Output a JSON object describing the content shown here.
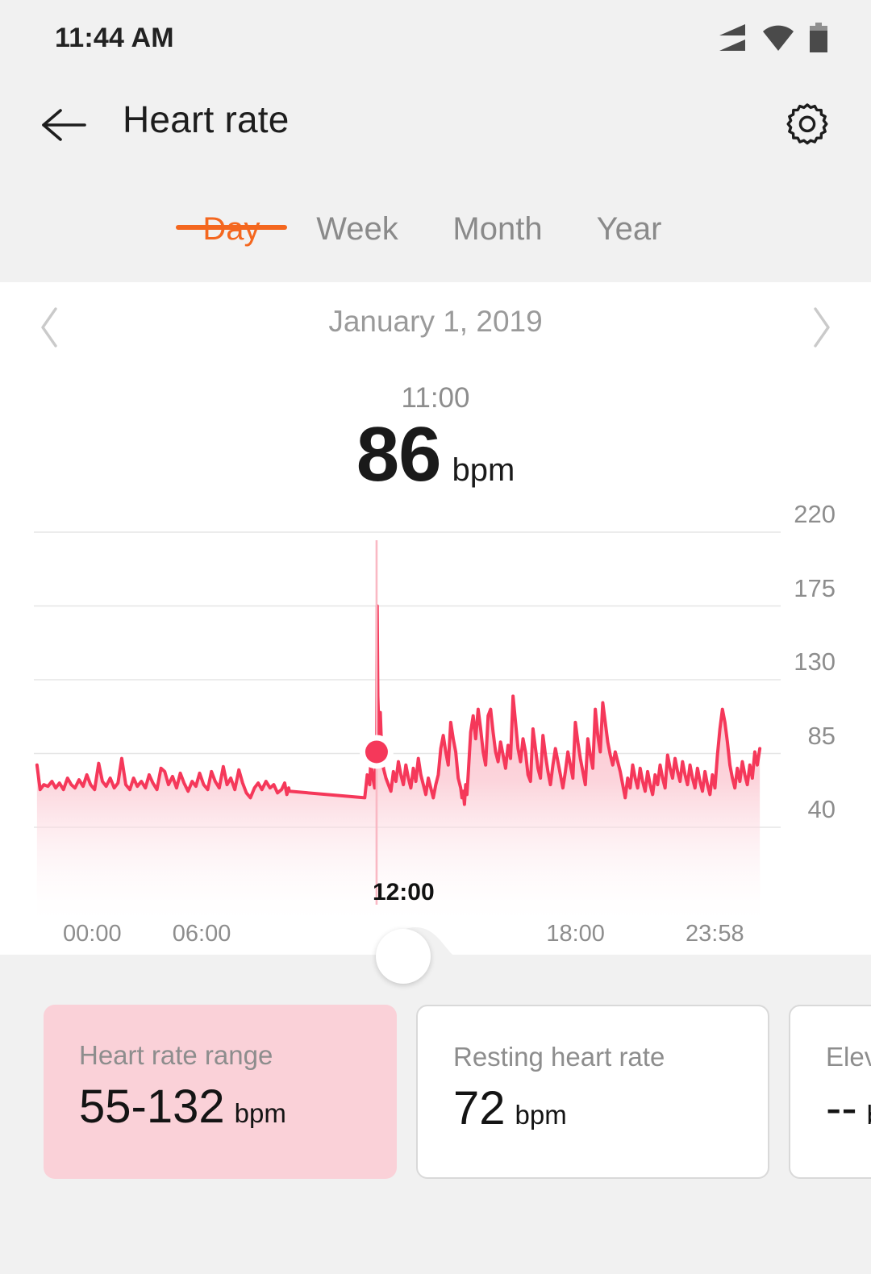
{
  "status_bar": {
    "time": "11:44 AM",
    "icons": [
      "signal-icon",
      "wifi-icon",
      "battery-icon"
    ]
  },
  "header": {
    "title": "Heart rate",
    "back_icon": "back-arrow-icon",
    "settings_icon": "gear-icon"
  },
  "tabs": {
    "items": [
      {
        "label": "Day",
        "active": true
      },
      {
        "label": "Week",
        "active": false
      },
      {
        "label": "Month",
        "active": false
      },
      {
        "label": "Year",
        "active": false
      }
    ],
    "active_color": "#f4671f",
    "inactive_color": "#8a8a8a"
  },
  "date_nav": {
    "prev_icon": "chevron-left-icon",
    "next_icon": "chevron-right-icon",
    "date": "January 1, 2019"
  },
  "reading": {
    "time": "11:00",
    "value": "86",
    "unit": "bpm"
  },
  "chart": {
    "marker_label": "12:00",
    "line_color": "#f5385a",
    "fill_color": "#f9b9c4",
    "marker_dot_color": "#f5385a"
  },
  "cards": [
    {
      "title": "Heart rate range",
      "value": "55-132",
      "unit": "bpm",
      "selected": true
    },
    {
      "title": "Resting heart rate",
      "value": "72",
      "unit": "bpm",
      "selected": false
    },
    {
      "title": "Elevated heart rate",
      "value": "--",
      "unit": "bpm",
      "selected": false
    }
  ],
  "chart_data": {
    "type": "area",
    "title": "",
    "xlabel": "",
    "ylabel": "bpm",
    "ylim": [
      40,
      220
    ],
    "xlim": [
      "00:00",
      "23:58"
    ],
    "grid": true,
    "legend": false,
    "ytick_labels": [
      "220",
      "175",
      "130",
      "85",
      "40"
    ],
    "ytick_values": [
      220,
      175,
      130,
      85,
      40
    ],
    "xtick_labels": [
      "00:00",
      "06:00",
      "12:00",
      "18:00",
      "23:58"
    ],
    "xtick_hours": [
      0,
      6,
      12,
      18,
      23.97
    ],
    "selected_point": {
      "time": "11:00",
      "value": 86
    },
    "marker_time_hours": 11.0,
    "summary": {
      "min": 55,
      "max": 132,
      "resting": 72
    },
    "series": [
      {
        "name": "Heart rate",
        "unit": "bpm",
        "gaps": [
          [
            8.2,
            10.6
          ],
          [
            23.3,
            23.97
          ]
        ],
        "points": [
          [
            0.1,
            78
          ],
          [
            0.2,
            63
          ],
          [
            0.32,
            66
          ],
          [
            0.45,
            65
          ],
          [
            0.58,
            68
          ],
          [
            0.7,
            64
          ],
          [
            0.82,
            67
          ],
          [
            0.95,
            63
          ],
          [
            1.08,
            70
          ],
          [
            1.2,
            66
          ],
          [
            1.32,
            64
          ],
          [
            1.45,
            69
          ],
          [
            1.58,
            65
          ],
          [
            1.7,
            72
          ],
          [
            1.82,
            66
          ],
          [
            1.95,
            63
          ],
          [
            2.08,
            79
          ],
          [
            2.2,
            68
          ],
          [
            2.32,
            65
          ],
          [
            2.45,
            70
          ],
          [
            2.58,
            64
          ],
          [
            2.7,
            67
          ],
          [
            2.82,
            82
          ],
          [
            2.95,
            66
          ],
          [
            3.08,
            63
          ],
          [
            3.2,
            70
          ],
          [
            3.32,
            65
          ],
          [
            3.45,
            68
          ],
          [
            3.58,
            64
          ],
          [
            3.7,
            72
          ],
          [
            3.82,
            67
          ],
          [
            3.95,
            63
          ],
          [
            4.08,
            76
          ],
          [
            4.2,
            74
          ],
          [
            4.32,
            66
          ],
          [
            4.45,
            71
          ],
          [
            4.58,
            64
          ],
          [
            4.7,
            73
          ],
          [
            4.82,
            67
          ],
          [
            4.95,
            62
          ],
          [
            5.08,
            68
          ],
          [
            5.2,
            65
          ],
          [
            5.32,
            73
          ],
          [
            5.45,
            66
          ],
          [
            5.58,
            63
          ],
          [
            5.7,
            74
          ],
          [
            5.82,
            68
          ],
          [
            5.95,
            64
          ],
          [
            6.08,
            77
          ],
          [
            6.2,
            66
          ],
          [
            6.32,
            70
          ],
          [
            6.45,
            63
          ],
          [
            6.58,
            75
          ],
          [
            6.7,
            67
          ],
          [
            6.82,
            61
          ],
          [
            6.95,
            58
          ],
          [
            7.08,
            64
          ],
          [
            7.2,
            67
          ],
          [
            7.32,
            63
          ],
          [
            7.45,
            68
          ],
          [
            7.58,
            64
          ],
          [
            7.7,
            66
          ],
          [
            7.82,
            61
          ],
          [
            7.95,
            63
          ],
          [
            8.05,
            67
          ],
          [
            8.12,
            60
          ],
          [
            8.18,
            64
          ],
          [
            8.2,
            62
          ],
          [
            10.62,
            58
          ],
          [
            10.7,
            72
          ],
          [
            10.78,
            66
          ],
          [
            10.82,
            83
          ],
          [
            10.88,
            70
          ],
          [
            10.94,
            64
          ],
          [
            11.0,
            86
          ],
          [
            11.02,
            175
          ],
          [
            11.04,
            120
          ],
          [
            11.08,
            96
          ],
          [
            11.12,
            110
          ],
          [
            11.16,
            88
          ],
          [
            11.22,
            76
          ],
          [
            11.3,
            70
          ],
          [
            11.38,
            66
          ],
          [
            11.46,
            62
          ],
          [
            11.54,
            74
          ],
          [
            11.62,
            68
          ],
          [
            11.7,
            80
          ],
          [
            11.78,
            72
          ],
          [
            11.86,
            66
          ],
          [
            11.94,
            78
          ],
          [
            12.02,
            70
          ],
          [
            12.1,
            64
          ],
          [
            12.18,
            76
          ],
          [
            12.26,
            68
          ],
          [
            12.34,
            82
          ],
          [
            12.42,
            72
          ],
          [
            12.5,
            66
          ],
          [
            12.58,
            60
          ],
          [
            12.66,
            70
          ],
          [
            12.74,
            64
          ],
          [
            12.82,
            58
          ],
          [
            12.9,
            66
          ],
          [
            12.98,
            72
          ],
          [
            13.06,
            88
          ],
          [
            13.14,
            96
          ],
          [
            13.22,
            86
          ],
          [
            13.3,
            78
          ],
          [
            13.38,
            104
          ],
          [
            13.46,
            94
          ],
          [
            13.54,
            86
          ],
          [
            13.62,
            70
          ],
          [
            13.7,
            64
          ],
          [
            13.74,
            58
          ],
          [
            13.78,
            62
          ],
          [
            13.82,
            54
          ],
          [
            13.86,
            66
          ],
          [
            13.9,
            60
          ],
          [
            13.94,
            72
          ],
          [
            14.02,
            98
          ],
          [
            14.1,
            108
          ],
          [
            14.18,
            94
          ],
          [
            14.26,
            112
          ],
          [
            14.34,
            100
          ],
          [
            14.42,
            86
          ],
          [
            14.5,
            78
          ],
          [
            14.58,
            108
          ],
          [
            14.66,
            112
          ],
          [
            14.74,
            98
          ],
          [
            14.82,
            86
          ],
          [
            14.9,
            80
          ],
          [
            14.98,
            92
          ],
          [
            15.06,
            84
          ],
          [
            15.14,
            76
          ],
          [
            15.22,
            90
          ],
          [
            15.3,
            82
          ],
          [
            15.38,
            120
          ],
          [
            15.46,
            104
          ],
          [
            15.54,
            88
          ],
          [
            15.62,
            80
          ],
          [
            15.7,
            94
          ],
          [
            15.78,
            86
          ],
          [
            15.86,
            72
          ],
          [
            15.94,
            68
          ],
          [
            16.02,
            100
          ],
          [
            16.1,
            88
          ],
          [
            16.18,
            76
          ],
          [
            16.26,
            70
          ],
          [
            16.34,
            96
          ],
          [
            16.42,
            84
          ],
          [
            16.5,
            74
          ],
          [
            16.58,
            66
          ],
          [
            16.66,
            78
          ],
          [
            16.74,
            88
          ],
          [
            16.82,
            80
          ],
          [
            16.9,
            72
          ],
          [
            16.98,
            64
          ],
          [
            17.06,
            74
          ],
          [
            17.14,
            86
          ],
          [
            17.22,
            78
          ],
          [
            17.3,
            70
          ],
          [
            17.38,
            104
          ],
          [
            17.46,
            92
          ],
          [
            17.54,
            82
          ],
          [
            17.62,
            74
          ],
          [
            17.7,
            66
          ],
          [
            17.78,
            94
          ],
          [
            17.86,
            84
          ],
          [
            17.94,
            76
          ],
          [
            18.02,
            112
          ],
          [
            18.1,
            96
          ],
          [
            18.18,
            86
          ],
          [
            18.26,
            116
          ],
          [
            18.34,
            104
          ],
          [
            18.42,
            92
          ],
          [
            18.5,
            84
          ],
          [
            18.58,
            78
          ],
          [
            18.66,
            86
          ],
          [
            18.74,
            80
          ],
          [
            18.82,
            74
          ],
          [
            18.9,
            66
          ],
          [
            18.98,
            58
          ],
          [
            19.06,
            70
          ],
          [
            19.14,
            64
          ],
          [
            19.22,
            78
          ],
          [
            19.3,
            70
          ],
          [
            19.38,
            64
          ],
          [
            19.46,
            76
          ],
          [
            19.54,
            68
          ],
          [
            19.62,
            62
          ],
          [
            19.7,
            74
          ],
          [
            19.78,
            66
          ],
          [
            19.86,
            60
          ],
          [
            19.94,
            72
          ],
          [
            20.02,
            66
          ],
          [
            20.1,
            78
          ],
          [
            20.18,
            70
          ],
          [
            20.26,
            64
          ],
          [
            20.34,
            84
          ],
          [
            20.42,
            76
          ],
          [
            20.5,
            70
          ],
          [
            20.58,
            82
          ],
          [
            20.66,
            74
          ],
          [
            20.74,
            68
          ],
          [
            20.82,
            80
          ],
          [
            20.9,
            72
          ],
          [
            20.98,
            66
          ],
          [
            21.06,
            78
          ],
          [
            21.14,
            70
          ],
          [
            21.22,
            64
          ],
          [
            21.3,
            76
          ],
          [
            21.38,
            68
          ],
          [
            21.46,
            62
          ],
          [
            21.54,
            74
          ],
          [
            21.62,
            66
          ],
          [
            21.7,
            60
          ],
          [
            21.78,
            72
          ],
          [
            21.86,
            64
          ],
          [
            21.94,
            84
          ],
          [
            22.02,
            100
          ],
          [
            22.1,
            112
          ],
          [
            22.18,
            104
          ],
          [
            22.26,
            92
          ],
          [
            22.34,
            78
          ],
          [
            22.42,
            70
          ],
          [
            22.5,
            64
          ],
          [
            22.58,
            76
          ],
          [
            22.66,
            68
          ],
          [
            22.74,
            80
          ],
          [
            22.82,
            72
          ],
          [
            22.9,
            66
          ],
          [
            22.98,
            78
          ],
          [
            23.06,
            70
          ],
          [
            23.14,
            86
          ],
          [
            23.22,
            78
          ],
          [
            23.3,
            88
          ]
        ]
      }
    ]
  }
}
